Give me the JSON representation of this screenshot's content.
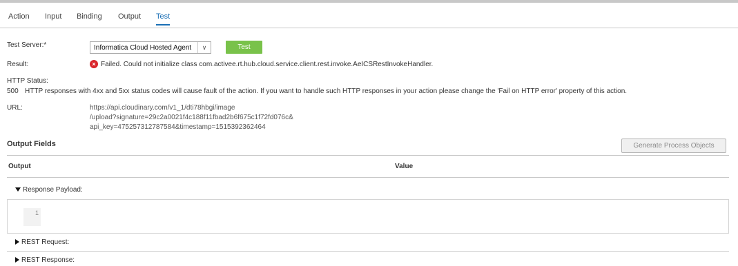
{
  "tabs": [
    {
      "label": "Action"
    },
    {
      "label": "Input"
    },
    {
      "label": "Binding"
    },
    {
      "label": "Output"
    },
    {
      "label": "Test",
      "active": true
    }
  ],
  "test_server": {
    "label": "Test Server:*",
    "selected": "Informatica Cloud Hosted Agent",
    "button_label": "Test"
  },
  "result": {
    "label": "Result:",
    "message": "Failed. Could not initialize class com.activee.rt.hub.cloud.service.client.rest.invoke.AeICSRestInvokeHandler.",
    "icon": "error-icon",
    "color": "#d9252b"
  },
  "http_status": {
    "label": "HTTP Status:",
    "code": "500",
    "message": "HTTP responses with 4xx and 5xx status codes will cause fault of the action. If you want to handle such HTTP responses in your action please change the 'Fail on HTTP error' property of this action."
  },
  "url": {
    "label": "URL:",
    "lines": [
      "https://api.cloudinary.com/v1_1/dti78hbgi/image",
      "/upload?signature=29c2a0021f4c188f11fbad2b6f675c1f72fd076c&",
      "api_key=475257312787584&timestamp=1515392362464"
    ]
  },
  "output_fields": {
    "title": "Output Fields",
    "generate_button": "Generate Process Objects",
    "columns": [
      "Output",
      "Value"
    ],
    "rows": [
      {
        "label": "Response Payload:",
        "expanded": true
      },
      {
        "label": "REST Request:",
        "expanded": false
      },
      {
        "label": "REST Response:",
        "expanded": false
      }
    ],
    "editor_line": "1"
  },
  "colors": {
    "accent": "#1a6fb5",
    "test_button": "#79c24a"
  }
}
